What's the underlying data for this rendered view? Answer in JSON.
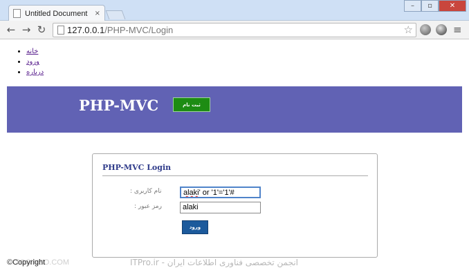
{
  "browser": {
    "tab_title": "Untitled Document",
    "tab_close": "×",
    "window_buttons": {
      "minimize": "–",
      "restore": "▫",
      "close": "✕"
    },
    "nav": {
      "back": "←",
      "forward": "→",
      "reload": "↻"
    },
    "url_host": "127.0.0.1",
    "url_path": "/PHP-MVC/Login",
    "star": "☆",
    "menu": "≡"
  },
  "page": {
    "nav_links": [
      "خانه",
      "ورود",
      "درباره"
    ],
    "brand": "PHP-MVC",
    "signup_label": "ثبت نام",
    "login_panel": {
      "title": "PHP-MVC Login",
      "username_label": "نام کاربری :",
      "password_label": "رمز عبور :",
      "username_value_a": "alaki",
      "username_value_b": "' or '1'='1'#",
      "password_value": "alaki",
      "submit_label": "ورود"
    },
    "copyright": "©Copyright",
    "watermark_left": "TOSINSO.COM",
    "watermark": "ITPro.ir - انجمن تخصصی فناوری اطلاعات ایران"
  },
  "colors": {
    "banner": "#6162b4",
    "signup_button": "#1d8c13",
    "login_button": "#1c5a9c",
    "panel_title": "#2f3b8a",
    "link": "#551a8b"
  },
  "icons": {
    "tab_favicon": "document-icon",
    "extension_1": "globe-icon",
    "extension_2": "extension-icon"
  }
}
